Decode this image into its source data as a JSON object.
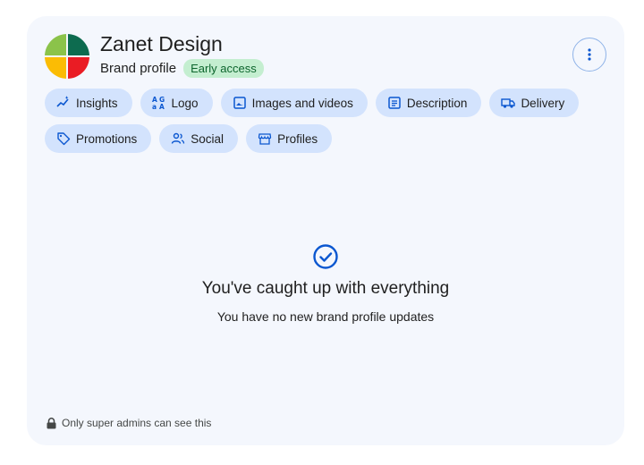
{
  "brand": {
    "name": "Zanet Design",
    "subtitle": "Brand profile",
    "badge": "Early access"
  },
  "chips": [
    {
      "label": "Insights",
      "icon": "insights-icon"
    },
    {
      "label": "Logo",
      "icon": "translate-icon"
    },
    {
      "label": "Images and videos",
      "icon": "image-icon"
    },
    {
      "label": "Description",
      "icon": "document-icon"
    },
    {
      "label": "Delivery",
      "icon": "truck-icon"
    },
    {
      "label": "Promotions",
      "icon": "tag-icon"
    },
    {
      "label": "Social",
      "icon": "people-icon"
    },
    {
      "label": "Profiles",
      "icon": "storefront-icon"
    }
  ],
  "empty_state": {
    "icon": "check-circle-icon",
    "title": "You've caught up with everything",
    "subtitle": "You have no new brand profile updates"
  },
  "footer": {
    "icon": "lock-icon",
    "text": "Only super admins can see this"
  },
  "more_menu_icon": "more-vert-icon",
  "colors": {
    "accent": "#0b57d0",
    "chip_bg": "#d3e3fd",
    "card_bg": "#f4f7fd",
    "badge_bg": "#c4eed0",
    "logo": [
      "#0d6b4f",
      "#34a853",
      "#fbbc04",
      "#ea4335",
      "#c5221f"
    ]
  }
}
